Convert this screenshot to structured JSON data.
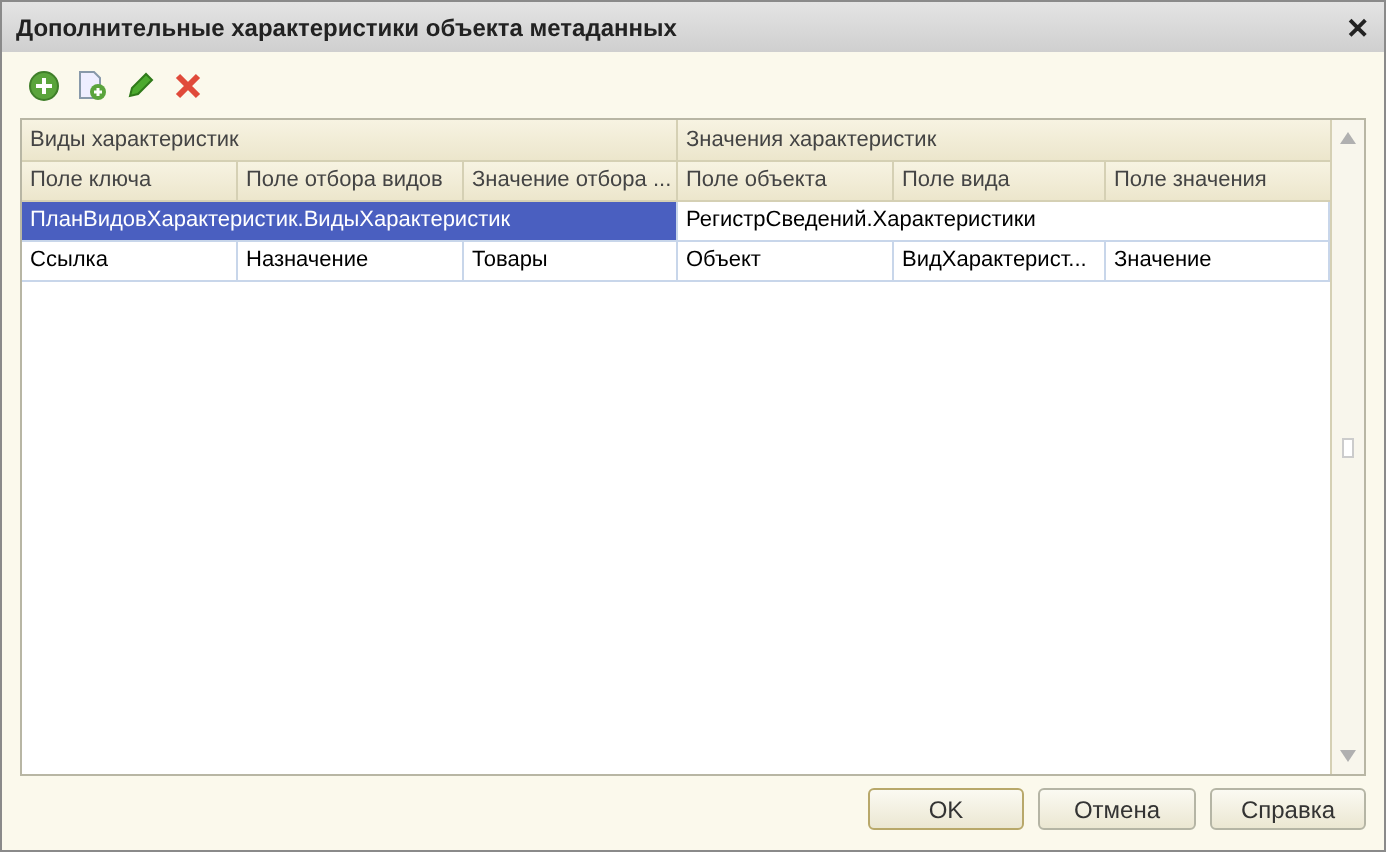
{
  "window": {
    "title": "Дополнительные характеристики объекта метаданных",
    "close": "✕"
  },
  "toolbar": [
    {
      "kind": "add"
    },
    {
      "kind": "copy"
    },
    {
      "kind": "edit"
    },
    {
      "kind": "delete"
    }
  ],
  "table": {
    "groups": [
      "Виды характеристик",
      "Значения характеристик"
    ],
    "columns": [
      "Поле ключа",
      "Поле отбора видов",
      "Значение отбора ...",
      "Поле объекта",
      "Поле вида",
      "Поле значения"
    ],
    "rows": [
      {
        "kind": "group",
        "selected": true,
        "cells": [
          "ПланВидовХарактеристик.ВидыХарактеристик",
          "",
          "",
          "РегистрСведений.Характеристики",
          "",
          ""
        ]
      },
      {
        "kind": "fields",
        "selected": false,
        "cells": [
          "Ссылка",
          "Назначение",
          "Товары",
          "Объект",
          "ВидХарактерист...",
          "Значение"
        ]
      }
    ]
  },
  "buttons": [
    "OK",
    "Отмена",
    "Справка"
  ]
}
